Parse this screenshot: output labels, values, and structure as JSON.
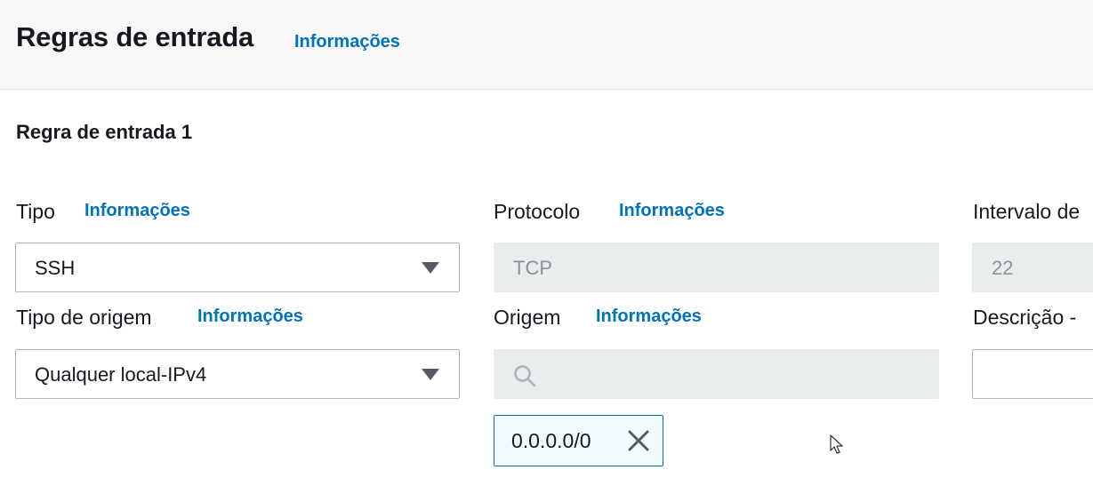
{
  "header": {
    "title": "Regras de entrada",
    "info": "Informações"
  },
  "rule": {
    "title": "Regra de entrada 1",
    "tipo": {
      "label": "Tipo",
      "info": "Informações",
      "value": "SSH"
    },
    "protocolo": {
      "label": "Protocolo",
      "info": "Informações",
      "value": "TCP"
    },
    "intervalo": {
      "label": "Intervalo de",
      "value": "22"
    },
    "tipo_origem": {
      "label": "Tipo de origem",
      "info": "Informações",
      "value": "Qualquer local-IPv4"
    },
    "origem": {
      "label": "Origem",
      "info": "Informações",
      "search_value": "",
      "token": "0.0.0.0/0"
    },
    "descricao": {
      "label": "Descrição -",
      "value": ""
    }
  },
  "icons": {
    "dropdown": "caret-down-icon",
    "search": "search-icon",
    "remove": "close-icon",
    "pointer": "mouse-cursor-icon"
  },
  "colors": {
    "link": "#0073bb",
    "header_bg": "#f7f7f7",
    "disabled_bg": "#eaeded",
    "token_bg": "#f1faff"
  }
}
